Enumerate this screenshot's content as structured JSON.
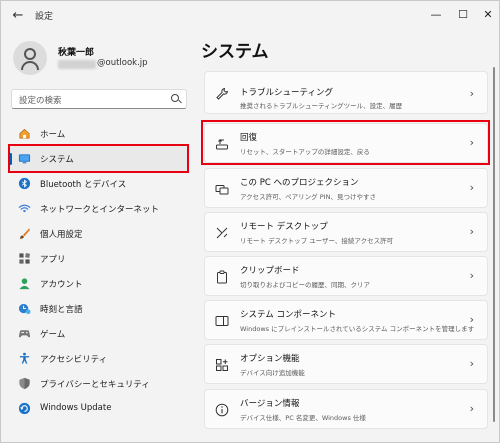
{
  "window": {
    "title": "設定",
    "back_glyph": "←",
    "min_glyph": "—",
    "max_glyph": "☐",
    "close_glyph": "✕"
  },
  "profile": {
    "name": "秋葉一郎",
    "email_suffix": "@outlook.jp"
  },
  "search": {
    "placeholder": "設定の検索"
  },
  "sidebar": {
    "items": [
      {
        "label": "ホーム",
        "icon": "home-icon"
      },
      {
        "label": "システム",
        "icon": "monitor-icon",
        "active": true
      },
      {
        "label": "Bluetooth とデバイス",
        "icon": "bluetooth-icon"
      },
      {
        "label": "ネットワークとインターネット",
        "icon": "wifi-icon"
      },
      {
        "label": "個人用設定",
        "icon": "brush-icon"
      },
      {
        "label": "アプリ",
        "icon": "apps-icon"
      },
      {
        "label": "アカウント",
        "icon": "account-icon"
      },
      {
        "label": "時刻と言語",
        "icon": "clock-globe-icon"
      },
      {
        "label": "ゲーム",
        "icon": "gamepad-icon"
      },
      {
        "label": "アクセシビリティ",
        "icon": "accessibility-icon"
      },
      {
        "label": "プライバシーとセキュリティ",
        "icon": "shield-icon"
      },
      {
        "label": "Windows Update",
        "icon": "update-icon"
      }
    ]
  },
  "main": {
    "title": "システム",
    "cards": [
      {
        "title": "トラブルシューティング",
        "subtitle": "推奨されるトラブルシューティングツール、設定、履歴",
        "icon": "wrench-icon"
      },
      {
        "title": "回復",
        "subtitle": "リセット、スタートアップの詳細設定、戻る",
        "icon": "recovery-icon"
      },
      {
        "title": "この PC へのプロジェクション",
        "subtitle": "アクセス許可、ペアリング PIN、見つけやすさ",
        "icon": "projection-icon"
      },
      {
        "title": "リモート デスクトップ",
        "subtitle": "リモート デスクトップ ユーザー、接続アクセス許可",
        "icon": "remote-desktop-icon"
      },
      {
        "title": "クリップボード",
        "subtitle": "切り取りおよびコピーの履歴、同期、クリア",
        "icon": "clipboard-icon"
      },
      {
        "title": "システム コンポーネント",
        "subtitle": "Windows にプレインストールされているシステム コンポーネントを管理します",
        "icon": "components-icon"
      },
      {
        "title": "オプション機能",
        "subtitle": "デバイス向け追加機能",
        "icon": "optional-features-icon"
      },
      {
        "title": "バージョン情報",
        "subtitle": "デバイス仕様、PC 名変更、Windows 仕様",
        "icon": "info-icon"
      }
    ],
    "chevron": "›"
  },
  "colors": {
    "accent": "#005fb8",
    "highlight": "#e60012"
  }
}
